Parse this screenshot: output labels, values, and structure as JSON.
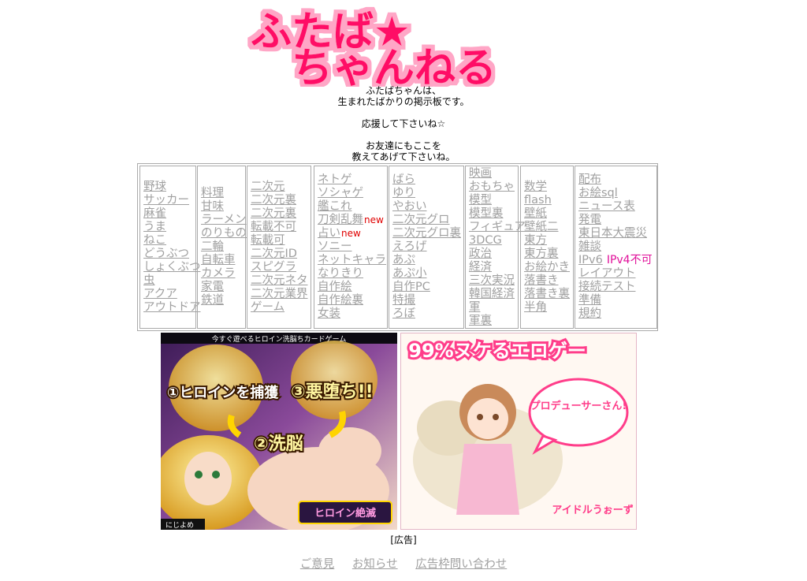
{
  "logo": {
    "line1": "ふたば★",
    "line2": "ちゃんねる"
  },
  "intro": {
    "lines": [
      "ふたばちゃんは、",
      "生まれたばかりの掲示板です。",
      "",
      "応援して下さいね☆",
      "",
      "お友達にもここを",
      "教えてあげて下さいね。"
    ]
  },
  "categories": [
    {
      "items": [
        {
          "label": "野球"
        },
        {
          "label": "サッカー"
        },
        {
          "label": "麻雀"
        },
        {
          "label": "うま"
        },
        {
          "label": "ねこ"
        },
        {
          "label": "どうぶつ"
        },
        {
          "label": "しょくぶつ"
        },
        {
          "label": "虫"
        },
        {
          "label": "アクア"
        },
        {
          "label": "アウトドア"
        }
      ]
    },
    {
      "items": [
        {
          "label": "料理"
        },
        {
          "label": "甘味"
        },
        {
          "label": "ラーメン"
        },
        {
          "label": "のりもの"
        },
        {
          "label": "二輪"
        },
        {
          "label": "自転車"
        },
        {
          "label": "カメラ"
        },
        {
          "label": "家電"
        },
        {
          "label": "鉄道"
        }
      ]
    },
    {
      "items": [
        {
          "label": "二次元"
        },
        {
          "label": "二次元裏"
        },
        {
          "label": "二次元裏"
        },
        {
          "label": "転載不可"
        },
        {
          "label": "転載可"
        },
        {
          "label": "二次元ID"
        },
        {
          "label": "スピグラ"
        },
        {
          "label": "二次元ネタ"
        },
        {
          "label": "二次元業界"
        },
        {
          "label": "ゲーム"
        }
      ]
    },
    {
      "items": [
        {
          "label": "ネトゲ"
        },
        {
          "label": "ソシャゲ"
        },
        {
          "label": "艦これ"
        },
        {
          "label": "刀剣乱舞",
          "tag": "new"
        },
        {
          "label": "占い",
          "tag": "new"
        },
        {
          "label": "ソニー"
        },
        {
          "label": "ネットキャラ"
        },
        {
          "label": "なりきり"
        },
        {
          "label": "自作絵"
        },
        {
          "label": "自作絵裏"
        },
        {
          "label": "女装"
        }
      ]
    },
    {
      "items": [
        {
          "label": "ばら"
        },
        {
          "label": "ゆり"
        },
        {
          "label": "やおい"
        },
        {
          "label": "二次元グロ"
        },
        {
          "label": "二次元グロ裏"
        },
        {
          "label": "えろげ"
        },
        {
          "label": "あぷ"
        },
        {
          "label": "あぷ小"
        },
        {
          "label": "自作PC"
        },
        {
          "label": "特撮"
        },
        {
          "label": "ろぼ"
        }
      ]
    },
    {
      "items": [
        {
          "label": "映画"
        },
        {
          "label": "おもちゃ"
        },
        {
          "label": "模型"
        },
        {
          "label": "模型裏"
        },
        {
          "label": "フィギュア"
        },
        {
          "label": "3DCG"
        },
        {
          "label": "政治"
        },
        {
          "label": "経済"
        },
        {
          "label": "三次実況"
        },
        {
          "label": "韓国経済"
        },
        {
          "label": "軍"
        },
        {
          "label": "軍裏"
        }
      ]
    },
    {
      "items": [
        {
          "label": "数学"
        },
        {
          "label": "flash"
        },
        {
          "label": "壁紙"
        },
        {
          "label": "壁紙二"
        },
        {
          "label": "東方"
        },
        {
          "label": "東方裏"
        },
        {
          "label": "お絵かき"
        },
        {
          "label": "落書き"
        },
        {
          "label": "落書き裏"
        },
        {
          "label": "半角"
        }
      ]
    },
    {
      "items": [
        {
          "label": "配布"
        },
        {
          "label": "お絵sql"
        },
        {
          "label": "ニュース表"
        },
        {
          "label": "発電"
        },
        {
          "label": "東日本大震災"
        },
        {
          "label": "雑談"
        },
        {
          "label": "IPv6",
          "tag": "IPv4不可"
        },
        {
          "label": "レイアウト"
        },
        {
          "label": "接続テスト"
        },
        {
          "label": "準備"
        },
        {
          "label": "規約"
        }
      ]
    }
  ],
  "ads": {
    "ad1": {
      "banner": "今すぐ遊べるヒロイン洗脳ちカードゲーム",
      "step1": "①ヒロインを捕獲",
      "step2": "②洗脳",
      "step3": "③悪堕ち!!",
      "logo": "ヒロイン絶滅",
      "brand": "にじよめ"
    },
    "ad2": {
      "headline": "99%ヌケるエロゲー",
      "bubble": "プロデューサーさん!",
      "logo": "アイドルうぉーず Z"
    },
    "caption": "[広告]"
  },
  "footer": {
    "links": [
      "ご意見",
      "お知らせ",
      "広告枠問い合わせ"
    ]
  },
  "colors": {
    "logo_fill": "#ff1166",
    "logo_glow": "#ff9fc0",
    "link": "#a0a0a0",
    "new_tag": "#e00000",
    "ipv4_tag": "#e0109a"
  }
}
